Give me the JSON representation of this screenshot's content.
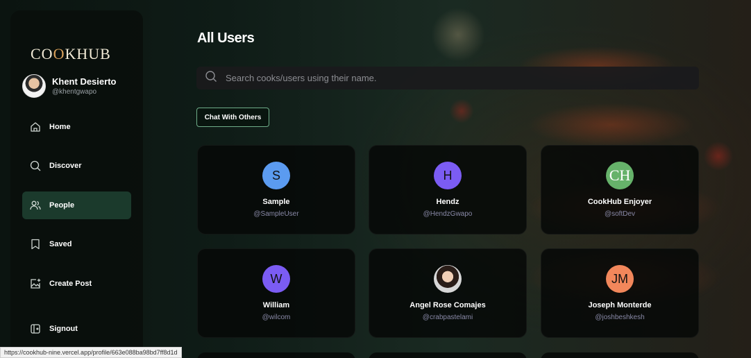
{
  "logo": {
    "text": "COOKHUB",
    "part1": "CO",
    "part2": "O",
    "part3": "KHUB"
  },
  "user": {
    "name": "Khent Desierto",
    "handle": "@khentgwapo"
  },
  "nav": {
    "home": "Home",
    "discover": "Discover",
    "people": "People",
    "saved": "Saved",
    "create_post": "Create Post",
    "signout": "Signout",
    "active": "People"
  },
  "main": {
    "title": "All Users",
    "search_placeholder": "Search cooks/users using their name.",
    "chat_button": "Chat With Others"
  },
  "users": [
    {
      "initials": "S",
      "name": "Sample",
      "handle": "@SampleUser",
      "color": "#5b9bf0"
    },
    {
      "initials": "H",
      "name": "Hendz",
      "handle": "@HendzGwapo",
      "color": "#7b5cf3"
    },
    {
      "initials": "CH",
      "name": "CookHub Enjoyer",
      "handle": "@softDev",
      "color": "#66b26a"
    },
    {
      "initials": "W",
      "name": "William",
      "handle": "@wilcom",
      "color": "#7b5cf3"
    },
    {
      "initials": "",
      "name": "Angel Rose Comajes",
      "handle": "@crabpastelami",
      "color": "#d9d9d9"
    },
    {
      "initials": "JM",
      "name": "Joseph Monterde",
      "handle": "@joshbeshkesh",
      "color": "#f2875b"
    }
  ],
  "status_bar": {
    "url": "https://cookhub-nine.vercel.app/profile/663e088ba98bd7ff8d1d"
  },
  "colors": {
    "active_nav": "#1b3a2c",
    "accent_border": "#6fae8a"
  }
}
